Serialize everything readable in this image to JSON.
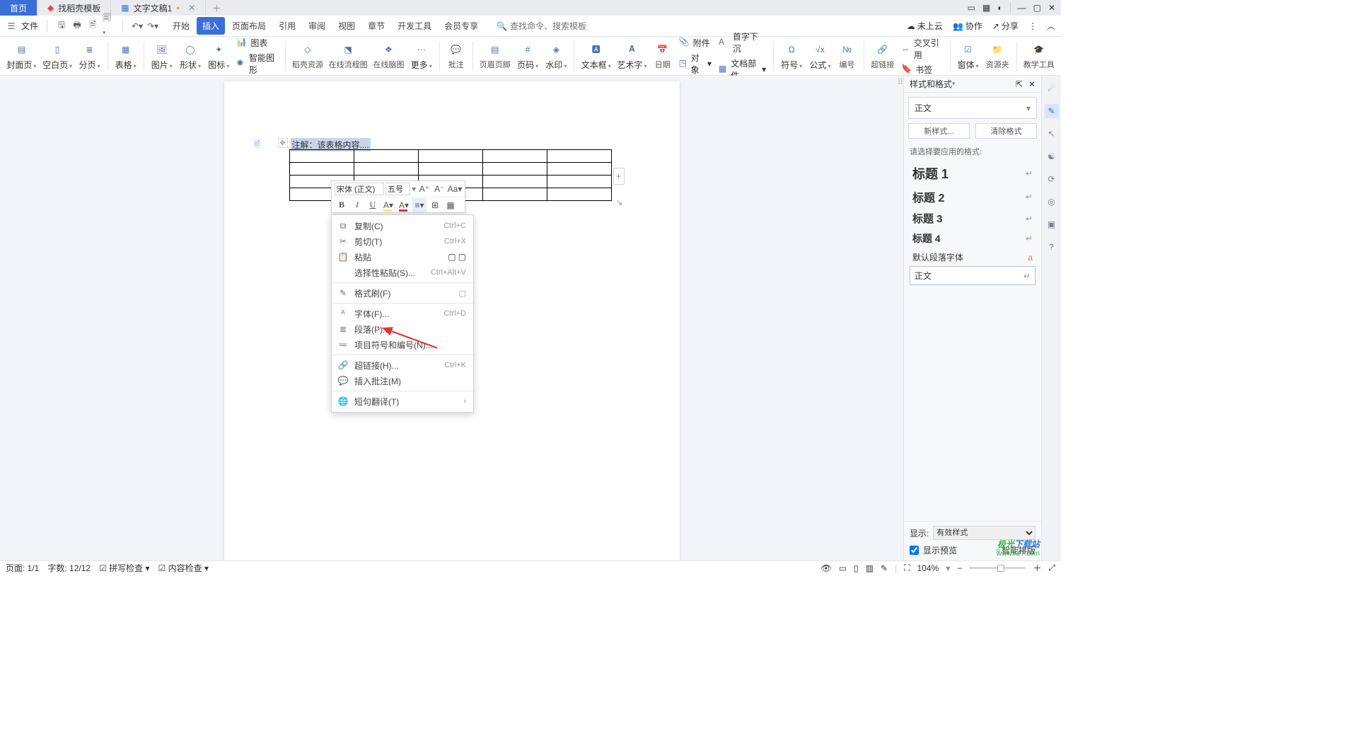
{
  "tabs": {
    "home": "首页",
    "template": "找稻壳模板",
    "doc": "文字文稿1"
  },
  "file_menu": "文件",
  "menu": {
    "start": "开始",
    "insert": "插入",
    "layout": "页面布局",
    "reference": "引用",
    "review": "审阅",
    "view": "视图",
    "chapter": "章节",
    "dev": "开发工具",
    "member": "会员专享"
  },
  "search_placeholder": "查找命令、搜索模板",
  "top_right": {
    "cloud": "未上云",
    "coop": "协作",
    "share": "分享"
  },
  "ribbon": {
    "cover": "封面页",
    "blank": "空白页",
    "pagebreak": "分页",
    "table": "表格",
    "pic": "图片",
    "shape": "形状",
    "icon": "图标",
    "chart": "图表",
    "smart": "智能图形",
    "docres": "稻壳资源",
    "flow": "在线流程图",
    "mind": "在线脑图",
    "more": "更多",
    "comment": "批注",
    "header": "页眉页脚",
    "pagenum": "页码",
    "watermark": "水印",
    "textbox": "文本框",
    "art": "艺术字",
    "date": "日期",
    "attach": "附件",
    "object": "对象",
    "docfield": "文档部件",
    "dropcap": "首字下沉",
    "symbol": "符号",
    "formula": "公式",
    "number": "编号",
    "link": "超链接",
    "bookmark": "书签",
    "cross": "交叉引用",
    "window": "窗体",
    "resource": "资源夹",
    "teach": "教学工具"
  },
  "note": "注解：该表格内容....",
  "mini": {
    "font": "宋体 (正文)",
    "size": "五号"
  },
  "ctx": {
    "copy": "复制(C)",
    "copy_sc": "Ctrl+C",
    "cut": "剪切(T)",
    "cut_sc": "Ctrl+X",
    "paste": "粘贴",
    "pastesp": "选择性粘贴(S)...",
    "pastesp_sc": "Ctrl+Alt+V",
    "brush": "格式刷(F)",
    "font": "字体(F)...",
    "font_sc": "Ctrl+D",
    "para": "段落(P)...",
    "bullets": "项目符号和编号(N)...",
    "hyper": "超链接(H)...",
    "hyper_sc": "Ctrl+K",
    "insertc": "插入批注(M)",
    "trans": "短句翻译(T)"
  },
  "panel": {
    "title": "样式和格式",
    "current": "正文",
    "new": "新样式...",
    "clear": "清除格式",
    "apply_label": "请选择要应用的格式:",
    "h1": "标题 1",
    "h2": "标题 2",
    "h3": "标题 3",
    "h4": "标题 4",
    "def": "默认段落字体",
    "body": "正文",
    "show": "显示:",
    "show_val": "有效样式",
    "smart": "智能排版",
    "preview": "显示预览"
  },
  "status": {
    "page": "页面: 1/1",
    "words": "字数: 12/12",
    "spell": "拼写检查",
    "content": "内容检查",
    "zoom": "104%"
  },
  "watermark": {
    "l1a": "极光",
    "l1b": "下载站",
    "l2": "www.xz7.com"
  }
}
